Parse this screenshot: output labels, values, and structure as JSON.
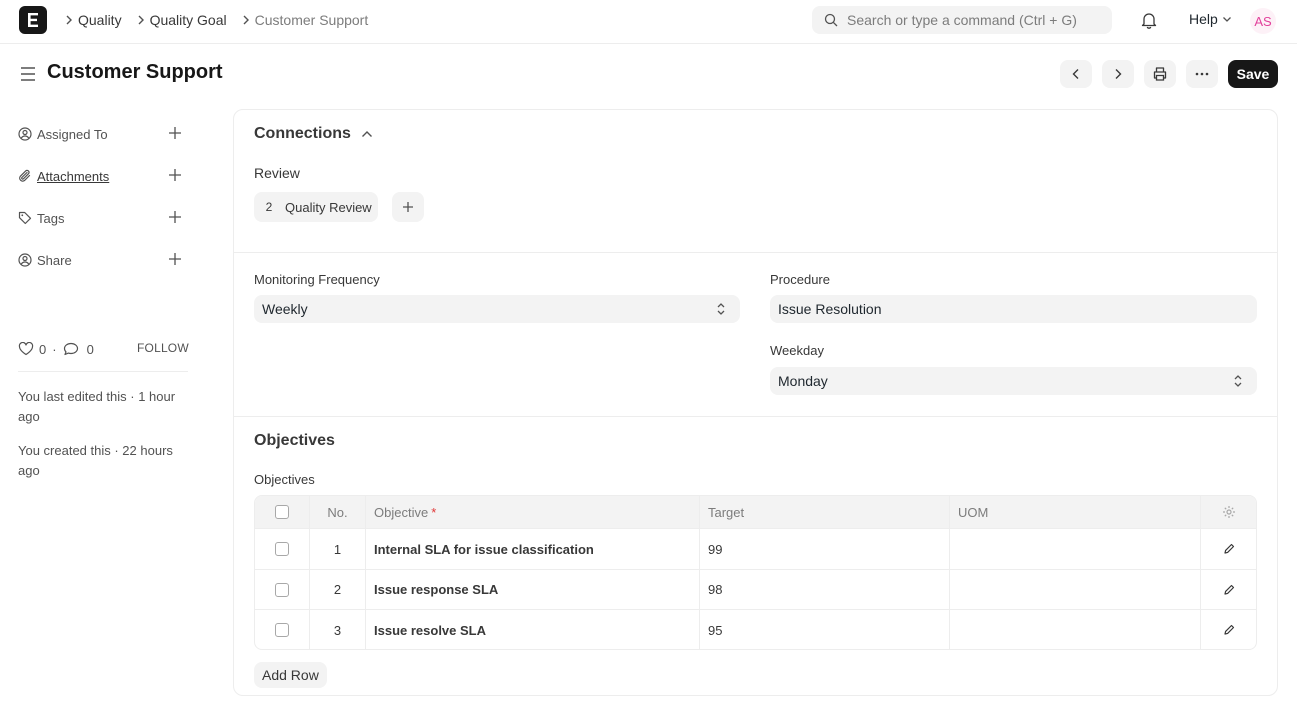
{
  "navbar": {
    "logo_letter": "E",
    "breadcrumbs": [
      "Quality",
      "Quality Goal",
      "Customer Support"
    ],
    "search_placeholder": "Search or type a command (Ctrl + G)",
    "help_label": "Help",
    "avatar_initials": "AS"
  },
  "page": {
    "title": "Customer Support",
    "save_label": "Save"
  },
  "sidebar": {
    "items": [
      {
        "label": "Assigned To"
      },
      {
        "label": "Attachments"
      },
      {
        "label": "Tags"
      },
      {
        "label": "Share"
      }
    ],
    "likes_count": "0",
    "comments_count": "0",
    "follow_label": "FOLLOW",
    "last_edited": "You last edited this · 1 hour ago",
    "created": "You created this · 22 hours ago"
  },
  "connections": {
    "title": "Connections",
    "review_label": "Review",
    "review_count": "2",
    "review_link": "Quality Review"
  },
  "form": {
    "monitoring_frequency_label": "Monitoring Frequency",
    "monitoring_frequency_value": "Weekly",
    "procedure_label": "Procedure",
    "procedure_value": "Issue Resolution",
    "weekday_label": "Weekday",
    "weekday_value": "Monday"
  },
  "objectives": {
    "section_title": "Objectives",
    "table_label": "Objectives",
    "columns": {
      "no": "No.",
      "objective": "Objective",
      "required_mark": "*",
      "target": "Target",
      "uom": "UOM"
    },
    "rows": [
      {
        "no": "1",
        "objective": "Internal SLA for issue classification",
        "target": "99",
        "uom": ""
      },
      {
        "no": "2",
        "objective": "Issue response SLA",
        "target": "98",
        "uom": ""
      },
      {
        "no": "3",
        "objective": "Issue resolve SLA",
        "target": "95",
        "uom": ""
      }
    ],
    "add_row_label": "Add Row"
  }
}
